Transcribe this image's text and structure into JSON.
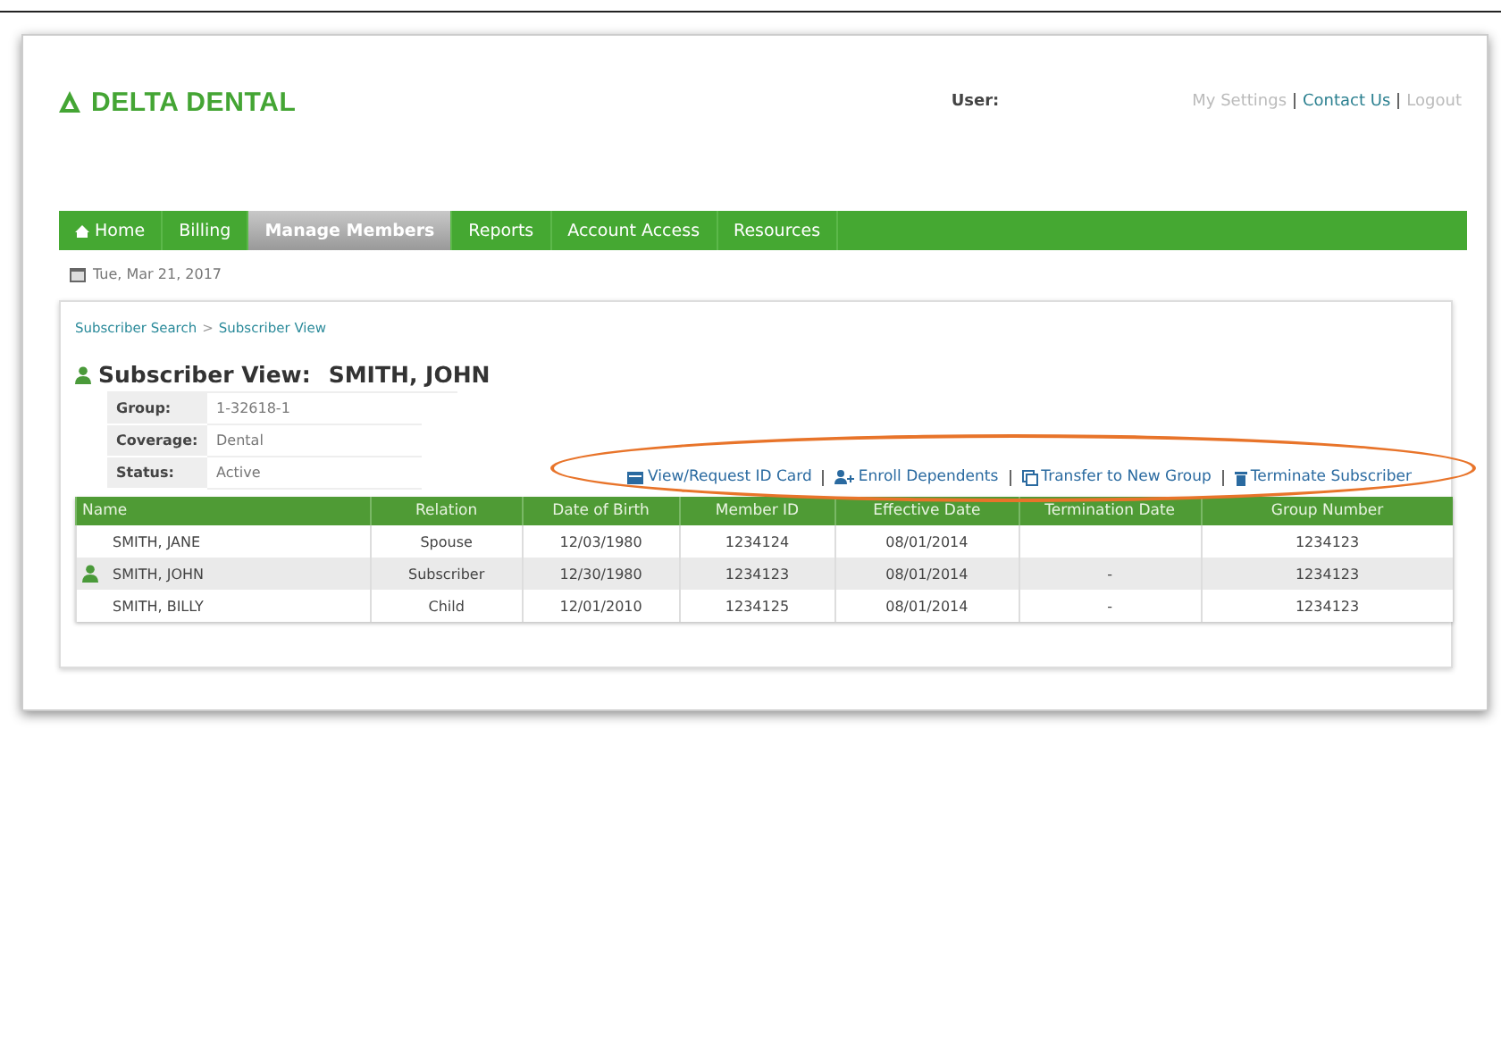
{
  "header": {
    "logo": "DELTA DENTAL",
    "user_label": "User:",
    "links": [
      {
        "label": "My Settings",
        "active": false
      },
      {
        "label": "Contact Us",
        "active": true
      },
      {
        "label": "Logout",
        "active": false
      }
    ]
  },
  "nav": [
    {
      "label": "Home",
      "kind": "home",
      "selected": false
    },
    {
      "label": "Billing",
      "kind": "plain",
      "selected": false
    },
    {
      "label": "Manage Members",
      "kind": "plain",
      "selected": true
    },
    {
      "label": "Reports",
      "kind": "plain",
      "selected": false
    },
    {
      "label": "Account Access",
      "kind": "plain",
      "selected": false
    },
    {
      "label": "Resources",
      "kind": "plain",
      "selected": false
    }
  ],
  "date": "Tue, Mar 21, 2017",
  "breadcrumb": {
    "items": [
      "Subscriber Search",
      "Subscriber View"
    ],
    "separator": ">"
  },
  "title": {
    "label": "Subscriber View:",
    "name": "SMITH, JOHN"
  },
  "info": [
    {
      "label": "Group:",
      "value": "1-32618-1"
    },
    {
      "label": "Coverage:",
      "value": "Dental"
    },
    {
      "label": "Status:",
      "value": "Active"
    }
  ],
  "actions": [
    {
      "label": "View/Request ID Card",
      "kind": "card"
    },
    {
      "label": "Enroll Dependents",
      "kind": "enroll"
    },
    {
      "label": "Transfer to New Group",
      "kind": "transfer"
    },
    {
      "label": "Terminate Subscriber",
      "kind": "trash"
    }
  ],
  "table": {
    "columns": [
      "Name",
      "Relation",
      "Date of Birth",
      "Member ID",
      "Effective Date",
      "Termination Date",
      "Group Number"
    ],
    "rows": [
      {
        "subscriber": false,
        "cells": [
          "SMITH, JANE",
          "Spouse",
          "12/03/1980",
          "1234124",
          "08/01/2014",
          "",
          "1234123"
        ]
      },
      {
        "subscriber": true,
        "cells": [
          "SMITH, JOHN",
          "Subscriber",
          "12/30/1980",
          "1234123",
          "08/01/2014",
          "-",
          "1234123"
        ]
      },
      {
        "subscriber": false,
        "cells": [
          "SMITH, BILLY",
          "Child",
          "12/01/2010",
          "1234125",
          "08/01/2014",
          "-",
          "1234123"
        ]
      }
    ]
  }
}
